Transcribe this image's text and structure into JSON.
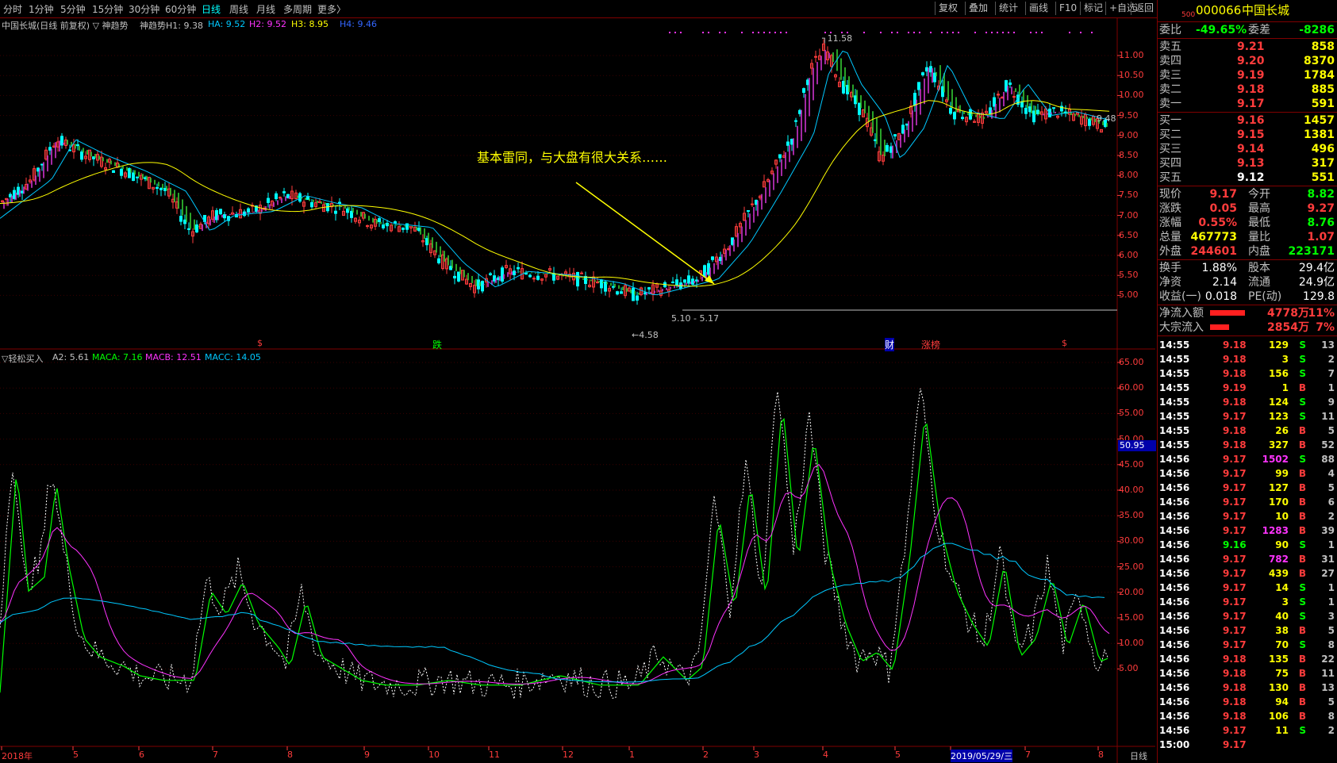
{
  "topbar": {
    "periods": [
      "分时",
      "1分钟",
      "5分钟",
      "15分钟",
      "30分钟",
      "60分钟",
      "日线",
      "周线",
      "月线",
      "多周期",
      "更多〉"
    ],
    "active": "日线",
    "right_buttons": [
      "复权",
      "叠加",
      "统计",
      "画线",
      "F10",
      "标记",
      "+自选",
      "返回"
    ]
  },
  "stock": {
    "code_prefix": "500",
    "code": "000066",
    "name": "中国长城"
  },
  "main_chart": {
    "legend_title": "中国长城(日线 前复权) ▽ 神趋势",
    "legend_items": [
      {
        "text": "神趋势H1: 9.38",
        "color": "#c0c0c0"
      },
      {
        "text": "HA: 9.52",
        "color": "#00c8ff"
      },
      {
        "text": "H2: 9.52",
        "color": "#ff33ff"
      },
      {
        "text": "H3: 8.95",
        "color": "#ffff00"
      },
      {
        "text": "H4: 9.46",
        "color": "#3366ff"
      }
    ],
    "annotation": "基本雷同，与大盘有很大关系……",
    "labels": {
      "high": "11.58",
      "low": "4.58",
      "range": "5.10 - 5.17",
      "last": "9.48"
    },
    "markers": [
      "$",
      "跌",
      "财",
      "涨榜",
      "$"
    ],
    "y_ticks": [
      "11.00",
      "10.50",
      "10.00",
      "9.50",
      "9.00",
      "8.50",
      "8.00",
      "7.50",
      "7.00",
      "6.50",
      "6.00",
      "5.50",
      "5.00"
    ]
  },
  "sub_chart": {
    "legend_title": "▽轻松买入",
    "legend_items": [
      {
        "text": "A2: 5.61",
        "color": "#c0c0c0"
      },
      {
        "text": "MACA: 7.16",
        "color": "#00ff00"
      },
      {
        "text": "MACB: 12.51",
        "color": "#ff33ff"
      },
      {
        "text": "MACC: 14.05",
        "color": "#00c8ff"
      }
    ],
    "y_ticks": [
      "65.00",
      "60.00",
      "55.00",
      "50.00",
      "45.00",
      "40.00",
      "35.00",
      "30.00",
      "25.00",
      "20.00",
      "15.00",
      "10.00",
      "5.00"
    ],
    "cursor_value": "50.95"
  },
  "x_axis": {
    "labels": [
      "2018年",
      "5",
      "6",
      "7",
      "8",
      "9",
      "10",
      "11",
      "12",
      "1",
      "2",
      "3",
      "4",
      "5",
      "2019/05/29/三",
      "7",
      "8"
    ],
    "period_label": "日线"
  },
  "quote": {
    "weibi_label": "委比",
    "weibi": "-49.65%",
    "weicha_label": "委差",
    "weicha": "-8286",
    "sell": [
      {
        "label": "卖五",
        "price": "9.21",
        "vol": "858"
      },
      {
        "label": "卖四",
        "price": "9.20",
        "vol": "8370"
      },
      {
        "label": "卖三",
        "price": "9.19",
        "vol": "1784"
      },
      {
        "label": "卖二",
        "price": "9.18",
        "vol": "885"
      },
      {
        "label": "卖一",
        "price": "9.17",
        "vol": "591"
      }
    ],
    "buy": [
      {
        "label": "买一",
        "price": "9.16",
        "vol": "1457"
      },
      {
        "label": "买二",
        "price": "9.15",
        "vol": "1381"
      },
      {
        "label": "买三",
        "price": "9.14",
        "vol": "496"
      },
      {
        "label": "买四",
        "price": "9.13",
        "vol": "317"
      },
      {
        "label": "买五",
        "price": "9.12",
        "vol": "551"
      }
    ],
    "stats": [
      {
        "l1": "现价",
        "v1": "9.17",
        "c1": "#ff3c3c",
        "l2": "今开",
        "v2": "8.82",
        "c2": "#00ff00"
      },
      {
        "l1": "涨跌",
        "v1": "0.05",
        "c1": "#ff3c3c",
        "l2": "最高",
        "v2": "9.27",
        "c2": "#ff3c3c"
      },
      {
        "l1": "涨幅",
        "v1": "0.55%",
        "c1": "#ff3c3c",
        "l2": "最低",
        "v2": "8.76",
        "c2": "#00ff00"
      },
      {
        "l1": "总量",
        "v1": "467773",
        "c1": "#ffff00",
        "l2": "量比",
        "v2": "1.07",
        "c2": "#ff3c3c"
      },
      {
        "l1": "外盘",
        "v1": "244601",
        "c1": "#ff3c3c",
        "l2": "内盘",
        "v2": "223171",
        "c2": "#00ff00"
      }
    ],
    "fin": [
      {
        "l1": "换手",
        "v1": "1.88%",
        "l2": "股本",
        "v2": "29.4亿"
      },
      {
        "l1": "净资",
        "v1": "2.14",
        "l2": "流通",
        "v2": "24.9亿"
      },
      {
        "l1": "收益(一)",
        "v1": "0.018",
        "l2": "PE(动)",
        "v2": "129.8"
      }
    ],
    "flow": [
      {
        "label": "净流入额",
        "val": "4778万",
        "pct": "11%"
      },
      {
        "label": "大宗流入",
        "val": "2854万",
        "pct": "7%"
      }
    ]
  },
  "ticks": [
    {
      "t": "14:55",
      "p": "9.18",
      "v": "129",
      "s": "S",
      "n": "13"
    },
    {
      "t": "14:55",
      "p": "9.18",
      "v": "3",
      "s": "S",
      "n": "2"
    },
    {
      "t": "14:55",
      "p": "9.18",
      "v": "156",
      "s": "S",
      "n": "7"
    },
    {
      "t": "14:55",
      "p": "9.19",
      "v": "1",
      "s": "B",
      "n": "1"
    },
    {
      "t": "14:55",
      "p": "9.18",
      "v": "124",
      "s": "S",
      "n": "9"
    },
    {
      "t": "14:55",
      "p": "9.17",
      "v": "123",
      "s": "S",
      "n": "11"
    },
    {
      "t": "14:55",
      "p": "9.18",
      "v": "26",
      "s": "B",
      "n": "5"
    },
    {
      "t": "14:55",
      "p": "9.18",
      "v": "327",
      "s": "B",
      "n": "52"
    },
    {
      "t": "14:56",
      "p": "9.17",
      "v": "1502",
      "s": "S",
      "n": "88"
    },
    {
      "t": "14:56",
      "p": "9.17",
      "v": "99",
      "s": "B",
      "n": "4"
    },
    {
      "t": "14:56",
      "p": "9.17",
      "v": "127",
      "s": "B",
      "n": "5"
    },
    {
      "t": "14:56",
      "p": "9.17",
      "v": "170",
      "s": "B",
      "n": "6"
    },
    {
      "t": "14:56",
      "p": "9.17",
      "v": "10",
      "s": "B",
      "n": "2"
    },
    {
      "t": "14:56",
      "p": "9.17",
      "v": "1283",
      "s": "B",
      "n": "39"
    },
    {
      "t": "14:56",
      "p": "9.16",
      "v": "90",
      "s": "S",
      "n": "1"
    },
    {
      "t": "14:56",
      "p": "9.17",
      "v": "782",
      "s": "B",
      "n": "31"
    },
    {
      "t": "14:56",
      "p": "9.17",
      "v": "439",
      "s": "B",
      "n": "27"
    },
    {
      "t": "14:56",
      "p": "9.17",
      "v": "14",
      "s": "S",
      "n": "1"
    },
    {
      "t": "14:56",
      "p": "9.17",
      "v": "3",
      "s": "S",
      "n": "1"
    },
    {
      "t": "14:56",
      "p": "9.17",
      "v": "40",
      "s": "S",
      "n": "3"
    },
    {
      "t": "14:56",
      "p": "9.17",
      "v": "38",
      "s": "B",
      "n": "5"
    },
    {
      "t": "14:56",
      "p": "9.17",
      "v": "70",
      "s": "S",
      "n": "8"
    },
    {
      "t": "14:56",
      "p": "9.18",
      "v": "135",
      "s": "B",
      "n": "22"
    },
    {
      "t": "14:56",
      "p": "9.18",
      "v": "75",
      "s": "B",
      "n": "11"
    },
    {
      "t": "14:56",
      "p": "9.18",
      "v": "130",
      "s": "B",
      "n": "13"
    },
    {
      "t": "14:56",
      "p": "9.18",
      "v": "94",
      "s": "B",
      "n": "5"
    },
    {
      "t": "14:56",
      "p": "9.18",
      "v": "106",
      "s": "B",
      "n": "8"
    },
    {
      "t": "14:56",
      "p": "9.17",
      "v": "11",
      "s": "S",
      "n": "2"
    },
    {
      "t": "15:00",
      "p": "9.17",
      "v": "",
      "s": "",
      "n": ""
    }
  ]
}
